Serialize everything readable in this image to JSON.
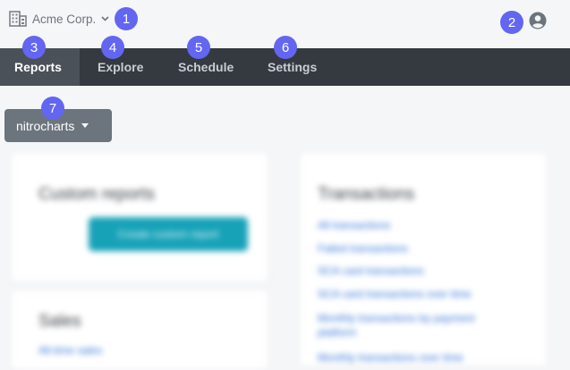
{
  "org": {
    "name": "Acme Corp.",
    "icon": "building-icon",
    "chevron": "chevron-down-icon"
  },
  "user": {
    "icon": "user-circle-icon"
  },
  "nav": {
    "tabs": [
      {
        "label": "Reports",
        "active": true
      },
      {
        "label": "Explore"
      },
      {
        "label": "Schedule"
      },
      {
        "label": "Settings"
      }
    ]
  },
  "project_dropdown": {
    "label": "nitrocharts"
  },
  "badges": [
    "1",
    "2",
    "3",
    "4",
    "5",
    "6",
    "7"
  ],
  "background": {
    "custom_reports": {
      "title": "Custom reports",
      "cta": "Create custom report"
    },
    "transactions": {
      "title": "Transactions",
      "links": [
        "All transactions",
        "Failed transactions",
        "SCA card transactions",
        "SCA card transactions over time",
        "Monthly transactions by payment platform",
        "Monthly transactions over time"
      ]
    },
    "sales": {
      "title": "Sales",
      "links": [
        "All-time sales"
      ]
    }
  },
  "colors": {
    "accent": "#6366f1",
    "nav_bg": "#343a40",
    "cta": "#17a2b8"
  }
}
